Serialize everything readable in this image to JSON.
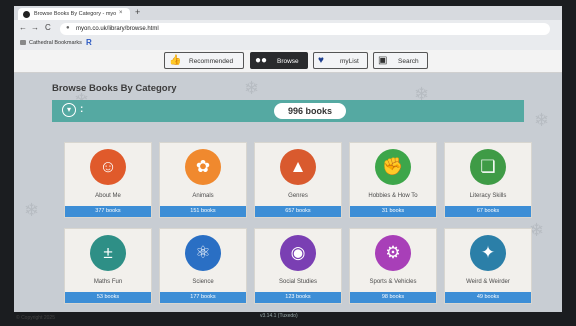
{
  "browser": {
    "tab_title": "Browse Books By Category - myo",
    "tab_close": "×",
    "new_tab": "+",
    "back": "←",
    "forward": "→",
    "reload": "C",
    "url": "myon.co.uk/library/browse.html",
    "bookmark_folder": "Cathedral Bookmarks",
    "bookmark_r": "R"
  },
  "nav": {
    "recommended": "Recommended",
    "browse": "Browse",
    "mylist": "myList",
    "search": "Search"
  },
  "page": {
    "title": "Browse Books By Category",
    "filter_colon": ":",
    "total": "996 books"
  },
  "categories": [
    {
      "name": "About Me",
      "count": "377 books",
      "color": "#e05a2b",
      "icon": "people-icon"
    },
    {
      "name": "Animals",
      "count": "151 books",
      "color": "#f0892e",
      "icon": "paw-icon"
    },
    {
      "name": "Genres",
      "count": "657 books",
      "color": "#d95a2e",
      "icon": "genres-icon"
    },
    {
      "name": "Hobbies & How To",
      "count": "31 books",
      "color": "#3da64a",
      "icon": "hobby-hand-icon"
    },
    {
      "name": "Literacy Skills",
      "count": "67 books",
      "color": "#3f9b46",
      "icon": "book-icon"
    },
    {
      "name": "Maths Fun",
      "count": "53 books",
      "color": "#2e8f86",
      "icon": "math-icon"
    },
    {
      "name": "Science",
      "count": "177 books",
      "color": "#2a6fc4",
      "icon": "atom-icon"
    },
    {
      "name": "Social Studies",
      "count": "123 books",
      "color": "#7a3fb3",
      "icon": "globe-icon"
    },
    {
      "name": "Sports & Vehicles",
      "count": "98 books",
      "color": "#a83fb8",
      "icon": "bike-icon"
    },
    {
      "name": "Weird & Weirder",
      "count": "49 books",
      "color": "#2b7fa8",
      "icon": "weird-icon"
    }
  ],
  "footer": {
    "copyright": "© Copyright 2025",
    "version": "v3.14.1 (Tuxedo)"
  }
}
